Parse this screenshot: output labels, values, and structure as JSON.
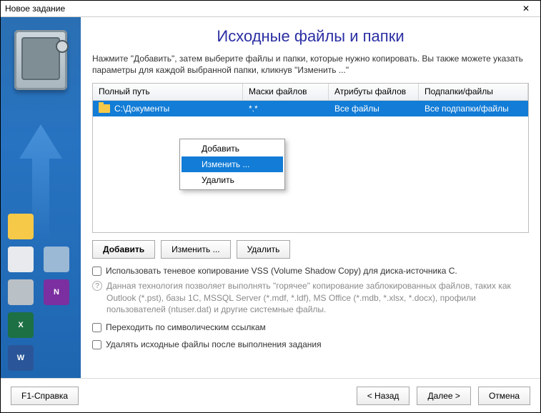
{
  "window": {
    "title": "Новое задание"
  },
  "page": {
    "heading": "Исходные файлы и папки",
    "description": "Нажмите \"Добавить\", затем выберите файлы и папки, которые нужно копировать. Вы также можете указать параметры для каждой выбранной папки, кликнув \"Изменить ...\""
  },
  "table": {
    "headers": {
      "path": "Полный путь",
      "masks": "Маски файлов",
      "attrs": "Атрибуты файлов",
      "subs": "Подпапки/файлы"
    },
    "row": {
      "path": "C:\\Документы",
      "masks": "*.*",
      "attrs": "Все файлы",
      "subs": "Все подпапки/файлы"
    }
  },
  "context_menu": {
    "add": "Добавить",
    "edit": "Изменить ...",
    "delete": "Удалить"
  },
  "buttons": {
    "add": "Добавить",
    "edit": "Изменить ...",
    "delete": "Удалить"
  },
  "options": {
    "vss_label": "Использовать теневое копирование VSS (Volume Shadow Copy) для диска-источника C.",
    "vss_hint": "Данная технология позволяет выполнять \"горячее\" копирование заблокированных файлов, таких как Outlook (*.pst), базы 1С, MSSQL Server (*.mdf, *.ldf), MS Office (*.mdb, *.xlsx, *.docx), профили пользователей (ntuser.dat) и другие системные файлы.",
    "follow_symlinks": "Переходить по символическим ссылкам",
    "delete_after": "Удалять исходные файлы после выполнения задания"
  },
  "footer": {
    "help": "F1-Справка",
    "back": "< Назад",
    "next": "Далее >",
    "cancel": "Отмена"
  },
  "icons": {
    "close": "✕",
    "question": "?"
  }
}
